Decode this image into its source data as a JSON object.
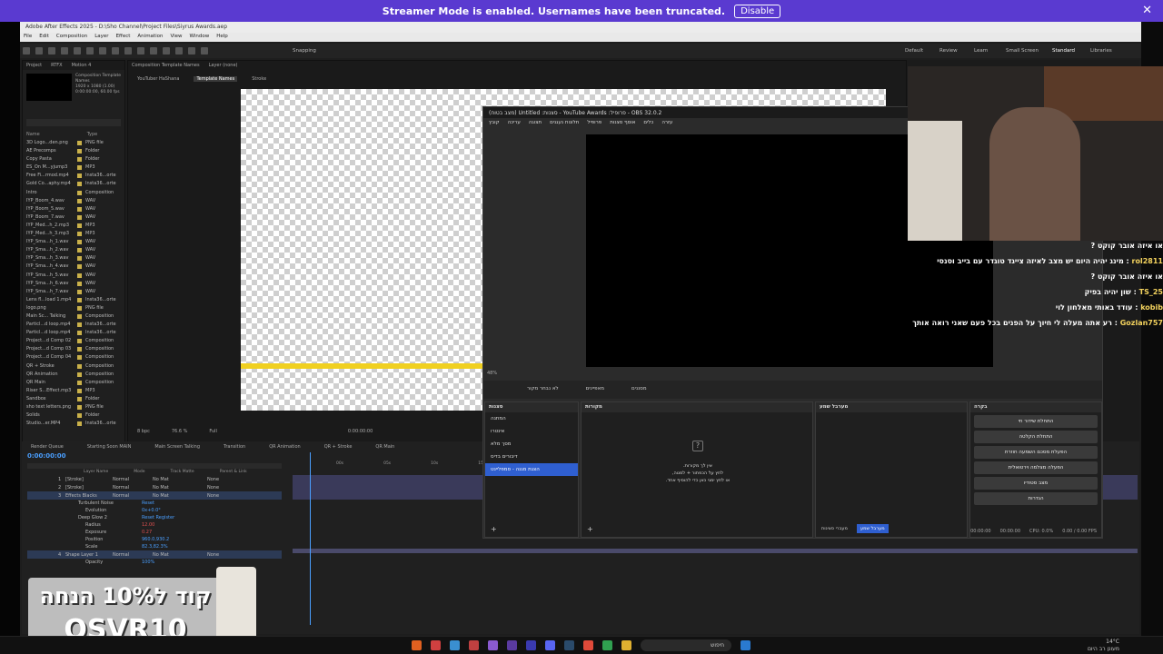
{
  "banner": {
    "text": "Streamer Mode is enabled. Usernames have been truncated.",
    "button": "Disable",
    "close": "✕"
  },
  "ae": {
    "title": "Adobe After Effects 2025 - D:\\Sho Channel\\Project Files\\Siyrus Awards.aep",
    "menu": [
      "File",
      "Edit",
      "Composition",
      "Layer",
      "Effect",
      "Animation",
      "View",
      "Window",
      "Help"
    ],
    "snapping": "Snapping",
    "workspaces": [
      "Default",
      "Review",
      "Learn",
      "Small Screen",
      "Standard",
      "Libraries"
    ],
    "project_tabs": [
      "Project",
      "RTFX",
      "Motion 4"
    ],
    "comp_info": [
      "Composition Template Names",
      "1920 x 1080 (1.00)",
      "0:00:00:00, 60.00 fps"
    ],
    "project_header": {
      "name": "Name",
      "type": "Type"
    },
    "project_items": [
      [
        "3D Logo...den.png",
        "PNG file"
      ],
      [
        "AE Precomps",
        "Folder"
      ],
      [
        "Copy Pasta",
        "Folder"
      ],
      [
        "ES_On M...yjump3",
        "MP3"
      ],
      [
        "Free Fi...rmod.mp4",
        "Insta36...orte"
      ],
      [
        "Gold Co...aphy.mp4",
        "Insta36...orte"
      ],
      [
        "Intro",
        "Composition"
      ],
      [
        "IYP_Boom_4.wav",
        "WAV"
      ],
      [
        "IYP_Boom_5.wav",
        "WAV"
      ],
      [
        "IYP_Boom_7.wav",
        "WAV"
      ],
      [
        "IYP_Med...h_2.mp3",
        "MP3"
      ],
      [
        "IYP_Med...h_3.mp3",
        "MP3"
      ],
      [
        "IYP_Sma...h_1.wav",
        "WAV"
      ],
      [
        "IYP_Sma...h_2.wav",
        "WAV"
      ],
      [
        "IYP_Sma...h_3.wav",
        "WAV"
      ],
      [
        "IYP_Sma...h_4.wav",
        "WAV"
      ],
      [
        "IYP_Sma...h_5.wav",
        "WAV"
      ],
      [
        "IYP_Sma...h_6.wav",
        "WAV"
      ],
      [
        "IYP_Sma...h_7.wav",
        "WAV"
      ],
      [
        "Lens fl...load 1.mp4",
        "Insta36...orte"
      ],
      [
        "logo.png",
        "PNG file"
      ],
      [
        "Main Sc... Talking",
        "Composition"
      ],
      [
        "Particl...d loop.mp4",
        "Insta36...orte"
      ],
      [
        "Particl...d loop.mp4",
        "Insta36...orte"
      ],
      [
        "Project...d Comp 02",
        "Composition"
      ],
      [
        "Project...d Comp 03",
        "Composition"
      ],
      [
        "Project...d Comp 04",
        "Composition"
      ],
      [
        "QR + Stroke",
        "Composition"
      ],
      [
        "QR Animation",
        "Composition"
      ],
      [
        "QR Main",
        "Composition"
      ],
      [
        "Riser S...Effect.mp3",
        "MP3"
      ],
      [
        "Sandbox",
        "Folder"
      ],
      [
        "sho text letters.png",
        "PNG file"
      ],
      [
        "Solids",
        "Folder"
      ],
      [
        "Studio...er.MP4",
        "Insta36...orte"
      ]
    ],
    "viewer_tabs": [
      "Composition Template Names",
      "Layer (none)"
    ],
    "breadcrumbs": [
      "YouTuber HaShana",
      "Template Names",
      "Stroke"
    ],
    "zoom": "76.6 %",
    "quality": "Full",
    "timecode_viewer": "0:00:00:00",
    "bpc": "8 bpc",
    "timeline_tabs": [
      "Render Queue",
      "Starting Soon MAIN",
      "Main Screen Talking",
      "Transition",
      "QR Animation",
      "QR + Stroke",
      "QR Main"
    ],
    "timecode": "0:00:00:00",
    "layer_header": [
      "Layer Name",
      "Mode",
      "Track Matte",
      "Parent & Link"
    ],
    "layers": [
      {
        "num": "1",
        "name": "[Stroke]",
        "mode": "Normal",
        "matte": "No Mat",
        "parent": "None"
      },
      {
        "num": "2",
        "name": "[Stroke]",
        "mode": "Normal",
        "matte": "No Mat",
        "parent": "None"
      },
      {
        "num": "3",
        "name": "Effects Blacks",
        "mode": "Normal",
        "matte": "No Mat",
        "parent": "None"
      }
    ],
    "props": [
      "Turbulent Noise",
      "Evolution",
      "Deep Glow 2",
      "Radius",
      "Exposure",
      "Position",
      "Scale"
    ],
    "prop_values": [
      "Reset",
      "0x+0.0°",
      "Reset  Register",
      "12.00",
      "0.27",
      "960.0,930.2",
      "82.3,82.3%"
    ],
    "layer4": {
      "num": "4",
      "name": "Shape Layer 1",
      "mode": "Normal",
      "matte": "No Mat",
      "parent": "None",
      "opacity_label": "Opacity",
      "opacity": "100%"
    },
    "ruler": [
      "00s",
      "05s",
      "10s",
      "15s",
      "20s"
    ]
  },
  "obs": {
    "title": "OBS 32.0.2 - פרופיל: YouTube Awards - סצנות: Untitled (מצב בטוח)",
    "menu": [
      "קובץ",
      "עריכה",
      "תצוגה",
      "חלונות נעגנים",
      "פרופיל",
      "אוסף סצנות",
      "כלים",
      "עזרה"
    ],
    "source_bar": {
      "none": "לא נבחר מקור",
      "props": "מאפיינים",
      "filters": "מסננים"
    },
    "zoom": "48%",
    "docks": {
      "scenes": "סצנות",
      "sources": "מקורות",
      "mixer": "מערבל שמע",
      "controls": "בקרה"
    },
    "scenes": [
      "המתנה",
      "אינטרו",
      "מסך מלא",
      "דיבורים בדיס",
      "הצגת מגנה - סמפליינט"
    ],
    "no_sources": [
      "אין לך מקורות.",
      "לחץ על הכפתור + למטה,",
      "או לחץ ימני כאן כדי להוסיף אחד."
    ],
    "controls": [
      "התחלת שידור חי",
      "התחלת הקלטה",
      "הפעלת מסכם השמעה חוזרת",
      "הפעלה מצלמה וירטואלית",
      "מצב סטודיו",
      "הגדרות"
    ],
    "mixer_tabs": [
      "מעברי סצינות",
      "מערבל שמע"
    ],
    "status": {
      "time1": "00:00:00",
      "time2": "00:00:00",
      "cpu": "CPU: 0.0%",
      "fps": "0.00 / 0.00 FPS"
    }
  },
  "chat": [
    {
      "user": "",
      "msg": "או איזה אובר קוקט ?"
    },
    {
      "user": "rol2811",
      "msg": "מינג יהיה היום יש מצב לאיזה צייגד טוגדר עם בייב וסנסי"
    },
    {
      "user": "",
      "msg": "או איזה אובר קוקט ?"
    },
    {
      "user": "TS_25",
      "msg": "שון יהיה בפיק"
    },
    {
      "user": "kobib",
      "msg": "עודד באותי מאלחון לוי"
    },
    {
      "user": "Gozlan757",
      "msg": "רע אתה מעלה לי חיוך על הפנים בכל פעם שאני רואה אותך"
    }
  ],
  "promo": {
    "line1": "קוד ל10% הנחה",
    "line2": "OSVR10"
  },
  "taskbar": {
    "search": "חיפוש",
    "weather_temp": "14°C",
    "weather_desc": "מעונן רב היום"
  },
  "colors": {
    "banner": "#5a3ad0",
    "obs_selected": "#2f5fd0",
    "username": "#f4d35e",
    "stroke_yellow": "#f0d020"
  }
}
